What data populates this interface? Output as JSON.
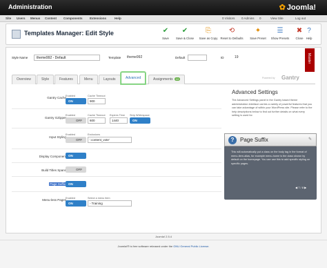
{
  "window": {
    "title": "Administration",
    "brand": "Joomla!"
  },
  "menubar": {
    "items": [
      "Site",
      "Users",
      "Menus",
      "Content",
      "Components",
      "Extensions",
      "Help"
    ],
    "status": [
      "0 Visitors",
      "0 Admins",
      "0",
      "View Site",
      "Log out"
    ]
  },
  "toolbar": {
    "title": "Templates Manager: Edit Style",
    "buttons": [
      {
        "label": "Save",
        "icon": "save-icon",
        "glyph": "✔",
        "color": "#2a9d3a"
      },
      {
        "label": "Save & Close",
        "icon": "save-close-icon",
        "glyph": "✔",
        "color": "#2a9d3a"
      },
      {
        "label": "Save as Copy",
        "icon": "save-copy-icon",
        "glyph": "⎘",
        "color": "#e08a00"
      },
      {
        "label": "Reset to Defaults",
        "icon": "reset-icon",
        "glyph": "⟲",
        "color": "#c43a2a"
      },
      {
        "label": "Save Preset",
        "icon": "save-preset-icon",
        "glyph": "✦",
        "color": "#e08a00"
      },
      {
        "label": "Show Presets",
        "icon": "show-presets-icon",
        "glyph": "☰",
        "color": "#3a78c0"
      },
      {
        "label": "Close",
        "icon": "close-icon",
        "glyph": "✖",
        "color": "#c43a2a"
      },
      {
        "label": "Help",
        "icon": "help-icon",
        "glyph": "?",
        "color": "#3a78c0"
      }
    ]
  },
  "style_bar": {
    "style_name_label": "Style Name",
    "style_name_value": "theme992 - Default",
    "template_label": "Template",
    "template_value": "theme992",
    "default_label": "Default",
    "id_label": "ID",
    "id_value": "19",
    "master_label": "Master"
  },
  "tabs": [
    {
      "label": "Overview"
    },
    {
      "label": "Style"
    },
    {
      "label": "Features"
    },
    {
      "label": "Menu"
    },
    {
      "label": "Layouts"
    },
    {
      "label": "Advanced"
    },
    {
      "label": "Assignments",
      "badge": "10"
    }
  ],
  "gantry": {
    "powered_by": "Powered by",
    "name": "Gantry"
  },
  "settings": {
    "gantry_cache": {
      "label": "Gantry Cache",
      "enabled_lbl": "Enabled",
      "enabled": "ON",
      "timeout_lbl": "Cache Timeout",
      "timeout": "900"
    },
    "gantry_gzipper": {
      "label": "Gantry GZipper",
      "enabled_lbl": "Enabled",
      "enabled": "OFF",
      "timeout_lbl": "Cache Timeout",
      "timeout": "600",
      "expires_lbl": "Expires Time",
      "expires": "1440",
      "strip_lbl": "Strip Whitespace",
      "strip": "ON"
    },
    "inputstyling": {
      "label": "Input Styling",
      "enabled_lbl": "Enabled",
      "enabled": "OFF",
      "exclusions_lbl": "Exclusions",
      "exclusions": "'.content_vote'"
    },
    "display_component": {
      "label": "Display Component",
      "value": "ON"
    },
    "build_titles": {
      "label": "Build Titles Spans",
      "value": "OFF"
    },
    "page_suffix": {
      "label": "Page Suffix",
      "value": "ON"
    },
    "menu_items": {
      "label": "Menu-less Pages",
      "enabled_lbl": "Enabled",
      "enabled": "ON",
      "select_lbl": "Select a menu item",
      "select_value": "- Training"
    }
  },
  "help": {
    "title": "Advanced Settings",
    "body": "The Advanced Settings panel in the Gantry based theme administration interface carries a variety of powerful features that you can take advantage of within your WordPress site. Please refer to the help descriptions below to find out further details on what every setting is used for."
  },
  "tip": {
    "title": "Page Suffix",
    "body": "This will automatically put a class on the body tag in the format of menu-item-alias, for example menu-home is the class shown by default on the homepage. You can use this to add specific styling on specific pages.",
    "pager": "7 / 8"
  },
  "footer": {
    "version": "Joomla! 2.5.4",
    "license_pre": "Joomla!® is free software released under the ",
    "license_link": "GNU General Public License",
    "license_post": "."
  }
}
